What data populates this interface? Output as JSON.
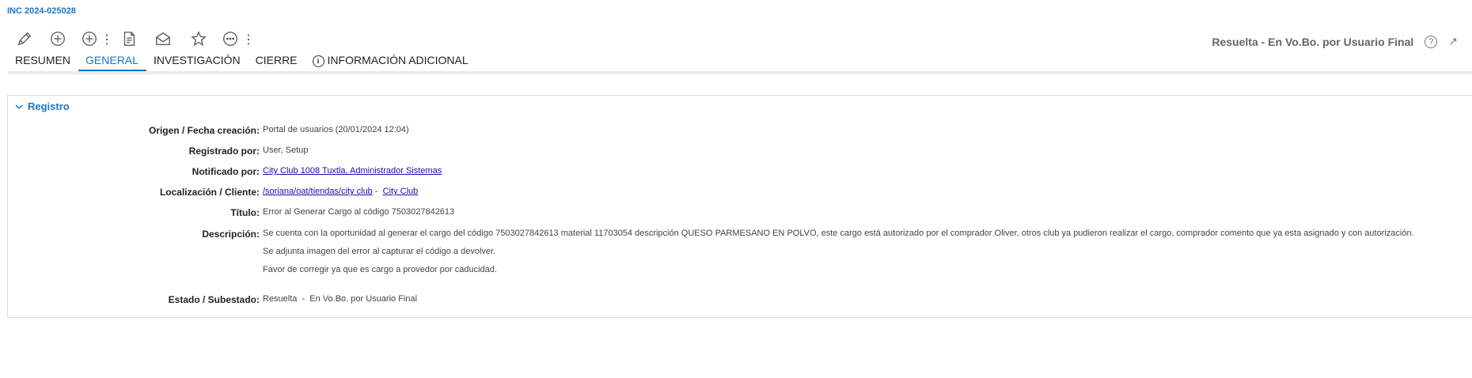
{
  "header": {
    "incident_id": "INC 2024-025028"
  },
  "toolbar": {
    "icons": [
      "pencil-icon",
      "add-icon",
      "add-more-icon",
      "pdf-document-icon",
      "open-envelope-icon",
      "star-icon",
      "more-icon"
    ]
  },
  "status": {
    "text": "Resuelta - En Vo.Bo. por Usuario Final",
    "help": "?",
    "expand": "↗"
  },
  "tabs": [
    {
      "label": "RESUMEN"
    },
    {
      "label": "GENERAL"
    },
    {
      "label": "INVESTIGACIÓN"
    },
    {
      "label": "CIERRE"
    },
    {
      "label": "INFORMACIÓN ADICIONAL",
      "icon": "info-icon"
    }
  ],
  "active_tab": "GENERAL",
  "colors": {
    "accent": "#1b75c4",
    "link": "#1a0dab"
  },
  "registro": {
    "title": "Registro",
    "fields": {
      "origen": {
        "label": "Origen / Fecha creación:",
        "value": "Portal de usuarios  (20/01/2024 12:04)"
      },
      "registrado": {
        "label": "Registrado por:",
        "value": "User, Setup"
      },
      "notificado": {
        "label": "Notificado por:",
        "link": "City Club 1008 Tuxtla, Administrador Sistemas"
      },
      "localizacion": {
        "label": "Localización / Cliente:",
        "link1": "/soriana/oat/tiendas/city club",
        "sep": " - ",
        "link2": "City Club"
      },
      "titulo": {
        "label": "Título:",
        "value": "Error al Generar Cargo al código 7503027842613"
      },
      "descripcion": {
        "label": "Descripción:",
        "paragraphs": [
          "Se cuenta con la oportunidad al generar el cargo del código 7503027842613  material 11703054  descripción QUESO PARMESANO EN POLVO, este cargo está autorizado por el comprador Oliver, otros club ya pudieron realizar el cargo, comprador comento que ya esta asignado y con autorización.",
          "Se adjunta imagen del error al capturar el código a devolver.",
          "Favor de corregir ya que es cargo a provedor por caducidad."
        ]
      },
      "estado": {
        "label": "Estado / Subestado:",
        "value": "Resuelta  -  En Vo.Bo. por Usuario Final"
      }
    }
  }
}
